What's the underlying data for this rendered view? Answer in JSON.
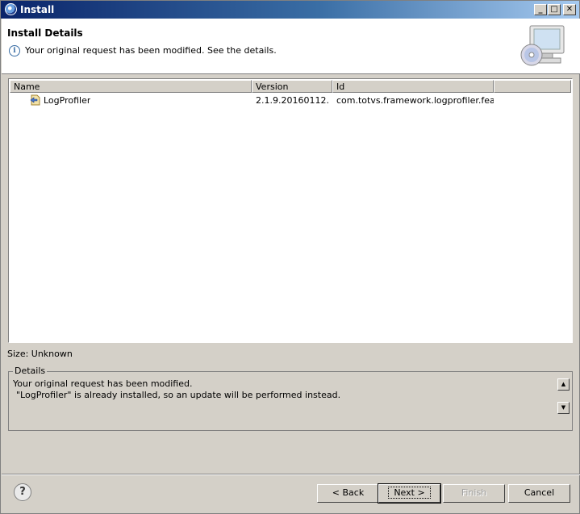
{
  "window": {
    "title": "Install"
  },
  "header": {
    "title": "Install Details",
    "message": "Your original request has been modified.  See the details."
  },
  "table": {
    "columns": [
      "Name",
      "Version",
      "Id"
    ],
    "rows": [
      {
        "name": "LogProfiler",
        "version": "2.1.9.20160112...",
        "id": "com.totvs.framework.logprofiler.feat..."
      }
    ]
  },
  "size": {
    "label": "Size: Unknown"
  },
  "details": {
    "legend": "Details",
    "line1": "Your original request has been modified.",
    "line2": "\"LogProfiler\" is already installed, so an update will be performed instead."
  },
  "buttons": {
    "back": "< Back",
    "next": "Next >",
    "finish": "Finish",
    "cancel": "Cancel"
  },
  "icons": {
    "app": "eclipse-icon",
    "info": "info-icon",
    "banner": "install-banner-icon",
    "feature": "feature-icon",
    "help": "help-icon"
  }
}
